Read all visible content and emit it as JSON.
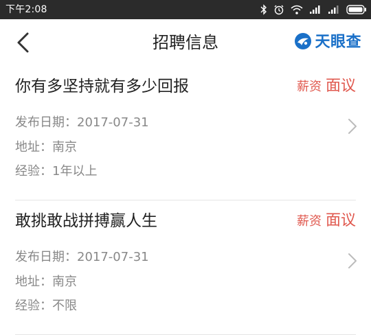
{
  "status_bar": {
    "time": "下午2:08",
    "icons": [
      "bluetooth-icon",
      "alarm-icon",
      "wifi-icon",
      "signal-icon",
      "signal-icon",
      "battery-icon"
    ]
  },
  "header": {
    "title": "招聘信息",
    "brand_name": "天眼查",
    "back_icon": "chevron-left-icon"
  },
  "jobs": [
    {
      "title": "你有多坚持就有多少回报",
      "salary_label": "薪资",
      "salary_value": "面议",
      "date": "发布日期：2017-07-31",
      "address": "地址：南京",
      "experience": "经验：1年以上"
    },
    {
      "title": "敢挑敢战拼搏赢人生",
      "salary_label": "薪资",
      "salary_value": "面议",
      "date": "发布日期：2017-07-31",
      "address": "地址：南京",
      "experience": "经验：不限"
    }
  ],
  "colors": {
    "status_bar": "#2b2b2b",
    "accent_red": "#e0584e",
    "brand_blue": "#1a70c8",
    "meta_gray": "#888888"
  }
}
